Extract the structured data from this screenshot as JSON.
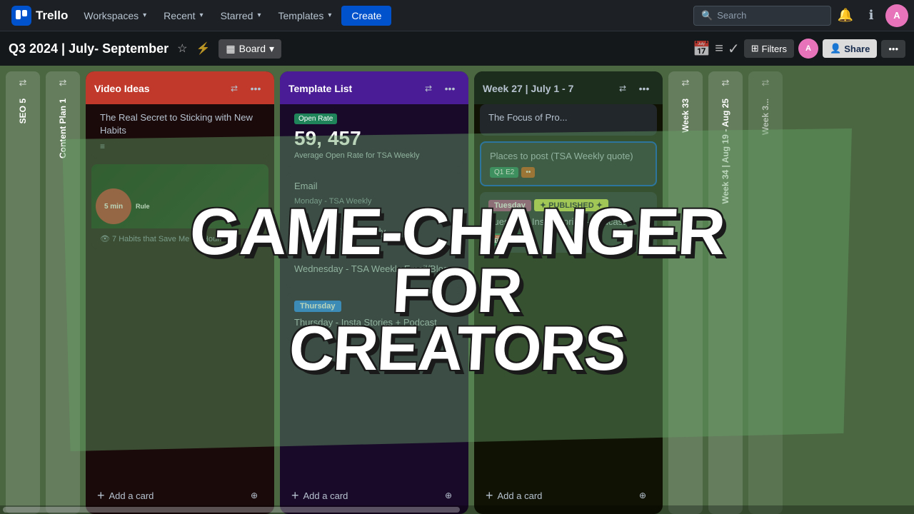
{
  "topnav": {
    "logo": "Trello",
    "workspaces_label": "Workspaces",
    "recent_label": "Recent",
    "starred_label": "Starred",
    "templates_label": "Templates",
    "create_label": "Create",
    "search_placeholder": "Search",
    "notification_icon": "bell-icon",
    "info_icon": "info-icon",
    "avatar_initials": "A"
  },
  "board_header": {
    "title": "Q3 2024 | July- September",
    "view_label": "Board",
    "filters_label": "Filters",
    "share_label": "Share"
  },
  "columns": {
    "seo": {
      "label": "SEO 5"
    },
    "content_plan": {
      "label": "Content Plan 1"
    },
    "video_ideas": {
      "label": "Video Ideas",
      "cards": [
        {
          "title": "The Real Secret to Sticking with New Habits",
          "has_description": true
        }
      ],
      "add_card": "Add a card"
    },
    "template_list": {
      "label": "Template List",
      "stats": {
        "number1": "59,",
        "number2": "457",
        "sublabel": "Average Open Rate for TSA Weekly"
      },
      "email_label": "Email",
      "monday_label": "Monday - TSA Weekly",
      "wednesday_label": "Wednesday - TSA Weekly Email/Blog",
      "thursday_label": "Thursday",
      "thursday_sub": "Thursday - Insta Stories + Podcast",
      "add_card": "Add a card"
    },
    "week27": {
      "label": "Week 27 | July 1 - 7",
      "card1_title": "The Focus of Pro...",
      "card2_title": "Places to post (TSA Weekly quote)",
      "tuesday_tag": "Tuesday",
      "published_tag": "✦ PUBLISHED ✦",
      "card3_title": "Tuesday - Insta Stories - Podcast",
      "date_tag": "Jul 2",
      "add_card": "Add a card"
    },
    "week33": {
      "label": "Week 33"
    },
    "week34": {
      "label": "Week 34 | Aug 19 - Aug 25"
    },
    "week35": {
      "label": "Week 3..."
    }
  },
  "overlay": {
    "line1": "GAME-CHANGER",
    "line2": "FOR CREATORS"
  }
}
